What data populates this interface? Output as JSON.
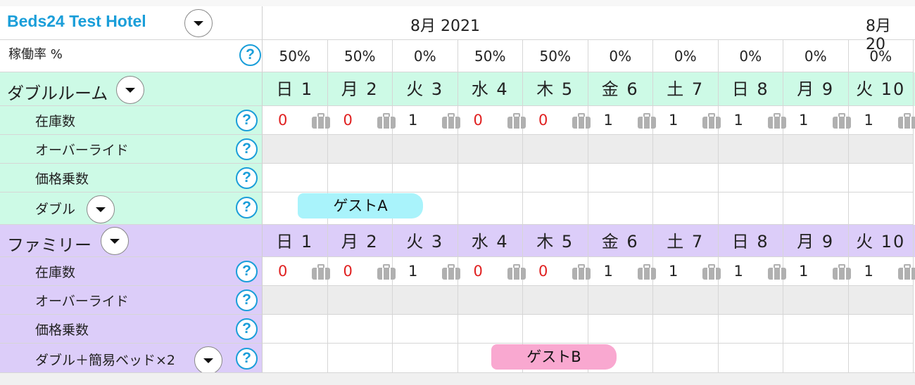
{
  "hotel": {
    "name": "Beds24 Test Hotel"
  },
  "months": {
    "current": "8月 2021",
    "next_partial": "8月 20"
  },
  "occupancy": {
    "label": "稼働率 %",
    "values": [
      "50%",
      "50%",
      "0%",
      "50%",
      "50%",
      "0%",
      "0%",
      "0%",
      "0%",
      "0%"
    ]
  },
  "days": [
    "日 1",
    "月 2",
    "火 3",
    "水 4",
    "木 5",
    "金 6",
    "土 7",
    "日 8",
    "月 9",
    "火 10"
  ],
  "rooms": [
    {
      "name": "ダブルルーム",
      "rows": {
        "inventory": "在庫数",
        "override": "オーバーライド",
        "multiplier": "価格乗数",
        "unit": "ダブル"
      },
      "inventory": [
        "0",
        "0",
        "1",
        "0",
        "0",
        "1",
        "1",
        "1",
        "1",
        "1"
      ],
      "booking": "ゲストA",
      "color": "#cdfae6"
    },
    {
      "name": "ファミリー",
      "rows": {
        "inventory": "在庫数",
        "override": "オーバーライド",
        "multiplier": "価格乗数",
        "unit": "ダブル＋簡易ベッド×2"
      },
      "inventory": [
        "0",
        "0",
        "1",
        "0",
        "0",
        "1",
        "1",
        "1",
        "1",
        "1"
      ],
      "booking": "ゲストB",
      "color": "#dccdf9"
    }
  ],
  "icons": {
    "help": "?",
    "dropdown": "caret-down-icon",
    "inventory": "suitcase-icon"
  },
  "colors": {
    "accent": "#1a9ed9",
    "zero": "#e02020",
    "booking_a": "#a9f3fb",
    "booking_b": "#f9a8d0"
  }
}
